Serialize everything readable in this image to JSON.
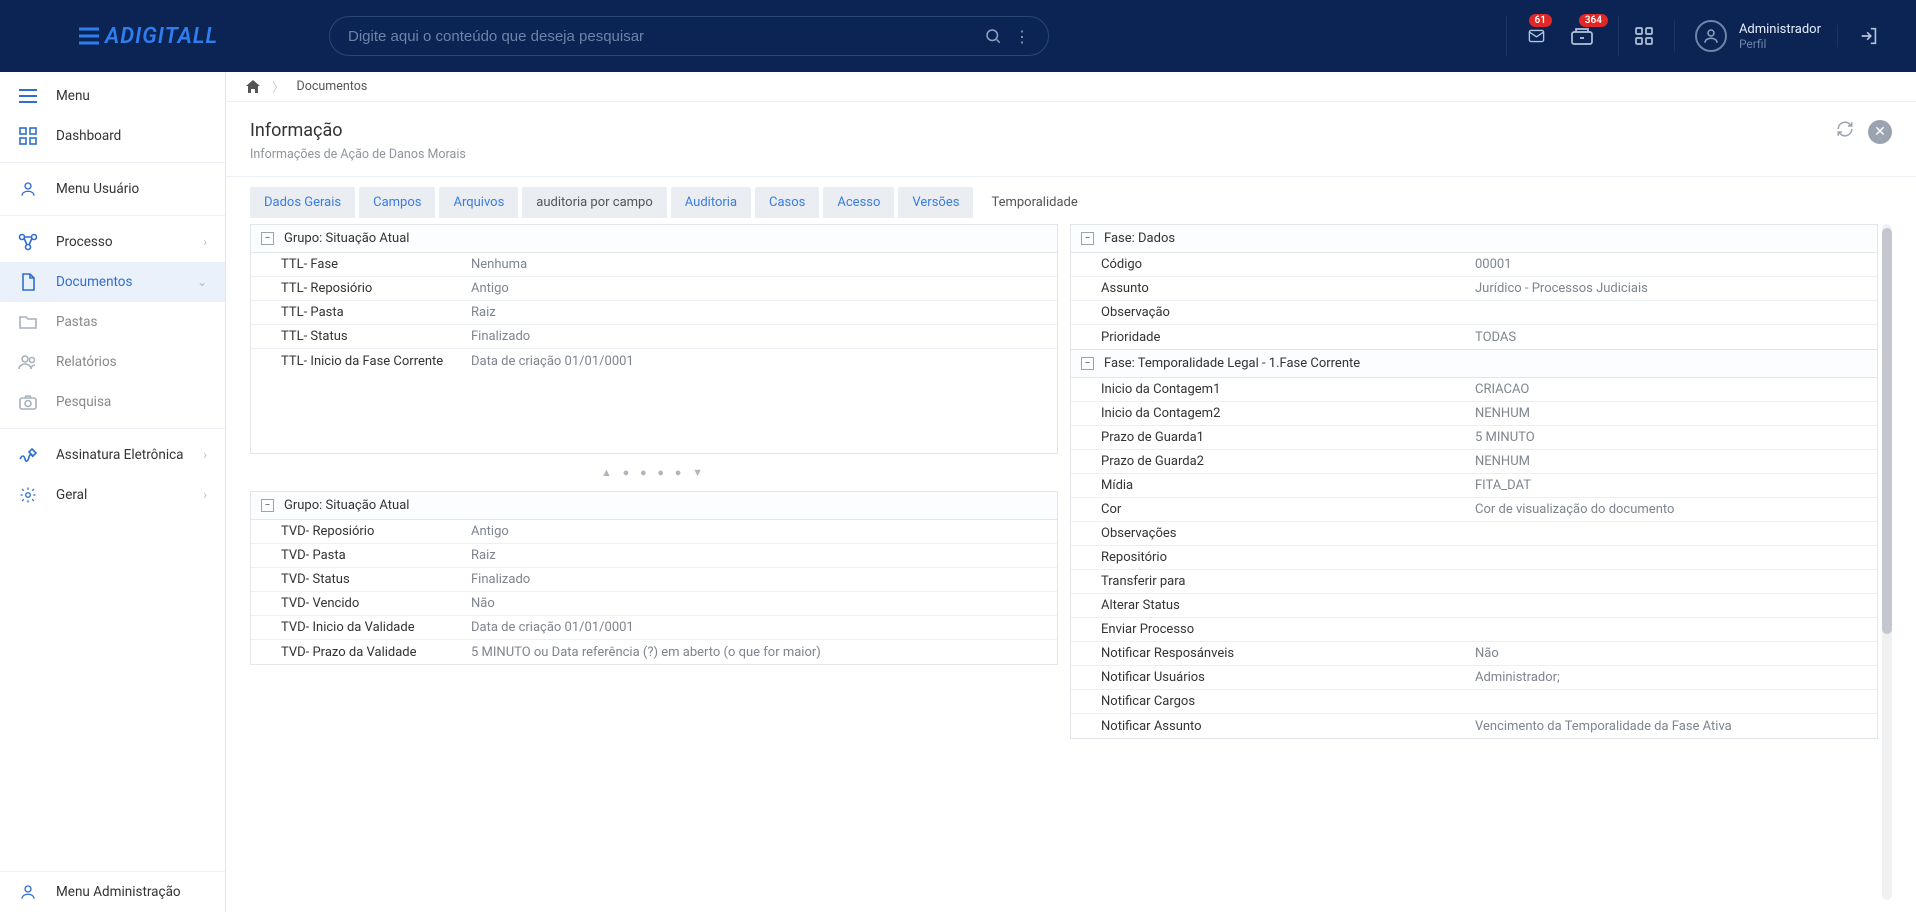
{
  "header": {
    "logo_text": "ADIGITALL",
    "search_placeholder": "Digite aqui o conteúdo que deseja pesquisar",
    "badges": {
      "mail": "61",
      "archive": "364"
    },
    "user_name": "Administrador",
    "user_role": "Perfil"
  },
  "sidebar": {
    "menu": "Menu",
    "dashboard": "Dashboard",
    "menu_usuario": "Menu Usuário",
    "processo": "Processo",
    "documentos": "Documentos",
    "pastas": "Pastas",
    "relatorios": "Relatórios",
    "pesquisa": "Pesquisa",
    "assinatura": "Assinatura Eletrônica",
    "geral": "Geral",
    "menu_admin": "Menu Administração"
  },
  "breadcrumb": {
    "item1": "Documentos"
  },
  "page": {
    "title": "Informação",
    "subtitle": "Informações de Ação de Danos Morais"
  },
  "tabs": {
    "dados_gerais": "Dados Gerais",
    "campos": "Campos",
    "arquivos": "Arquivos",
    "auditoria_campo": "auditoria por campo",
    "auditoria": "Auditoria",
    "casos": "Casos",
    "acesso": "Acesso",
    "versoes": "Versões",
    "temporalidade": "Temporalidade"
  },
  "left": {
    "g1": {
      "title": "Grupo: Situação Atual",
      "r": [
        {
          "k": "TTL- Fase",
          "v": "Nenhuma"
        },
        {
          "k": "TTL- Reposiório",
          "v": "Antigo"
        },
        {
          "k": "TTL- Pasta",
          "v": "Raiz"
        },
        {
          "k": "TTL- Status",
          "v": "Finalizado"
        },
        {
          "k": "TTL- Inicio da Fase Corrente",
          "v": "Data de criação 01/01/0001"
        }
      ]
    },
    "g2": {
      "title": "Grupo: Situação Atual",
      "r": [
        {
          "k": "TVD- Reposiório",
          "v": "Antigo"
        },
        {
          "k": "TVD- Pasta",
          "v": "Raiz"
        },
        {
          "k": "TVD- Status",
          "v": "Finalizado"
        },
        {
          "k": "TVD- Vencido",
          "v": "Não"
        },
        {
          "k": "TVD- Inicio da Validade",
          "v": "Data de criação 01/01/0001"
        },
        {
          "k": "TVD- Prazo da Validade",
          "v": "5 MINUTO ou Data referência (?) em aberto (o que for maior)"
        }
      ]
    }
  },
  "right": {
    "g1": {
      "title": "Fase: Dados",
      "r": [
        {
          "k": "Código",
          "v": "00001"
        },
        {
          "k": "Assunto",
          "v": "Jurídico - Processos Judiciais"
        },
        {
          "k": "Observação",
          "v": ""
        },
        {
          "k": "Prioridade",
          "v": "TODAS"
        }
      ]
    },
    "g2": {
      "title": "Fase: Temporalidade Legal - 1.Fase Corrente",
      "r": [
        {
          "k": "Inicio da Contagem1",
          "v": "CRIACAO"
        },
        {
          "k": "Inicio da Contagem2",
          "v": "NENHUM"
        },
        {
          "k": "Prazo de Guarda1",
          "v": "5 MINUTO"
        },
        {
          "k": "Prazo de Guarda2",
          "v": "NENHUM"
        },
        {
          "k": "Mídia",
          "v": "FITA_DAT"
        },
        {
          "k": "Cor",
          "v": "Cor de visualização do documento"
        },
        {
          "k": "Observações",
          "v": ""
        },
        {
          "k": "Repositório",
          "v": ""
        },
        {
          "k": "Transferir para",
          "v": ""
        },
        {
          "k": "Alterar Status",
          "v": ""
        },
        {
          "k": "Enviar Processo",
          "v": ""
        },
        {
          "k": "Notificar Resposánveis",
          "v": "Não"
        },
        {
          "k": "Notificar Usuários",
          "v": "Administrador;"
        },
        {
          "k": "Notificar Cargos",
          "v": ""
        },
        {
          "k": "Notificar Assunto",
          "v": "Vencimento da Temporalidade da Fase Ativa"
        }
      ]
    }
  }
}
